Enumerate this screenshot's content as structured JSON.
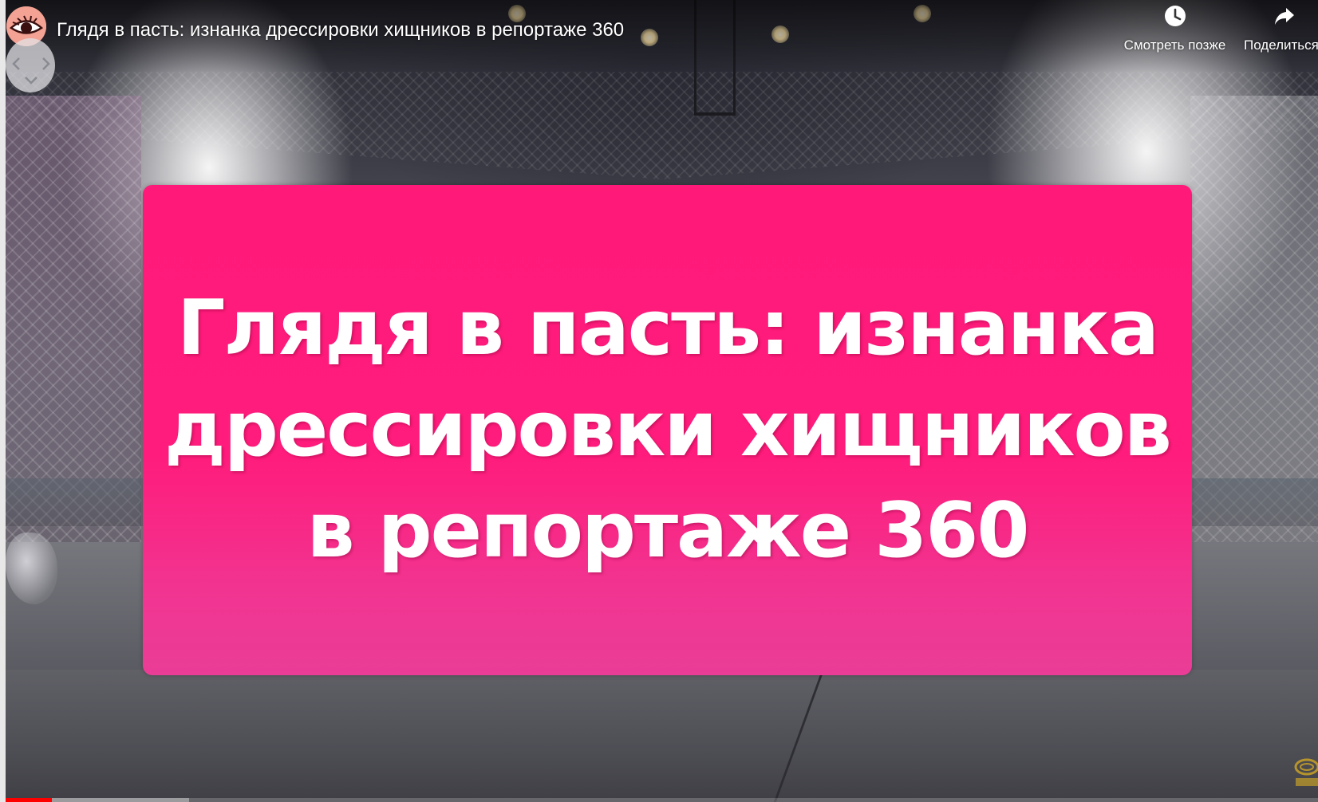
{
  "video": {
    "title": "Глядя в пасть: изнанка дрессировки хищников в репортаже 360",
    "overlay_text": "Глядя в пасть: изнанка дрессировки хищников в репортаже 360"
  },
  "actions": {
    "watch_later": {
      "label": "Смотреть позже",
      "icon": "clock-icon"
    },
    "share": {
      "label": "Поделиться",
      "icon": "share-arrow-icon"
    }
  },
  "navigation": {
    "icons": [
      "chevron-left-icon",
      "chevron-right-icon",
      "chevron-down-icon"
    ]
  },
  "channel": {
    "avatar_icon": "eye-icon"
  },
  "watermark": {
    "icon": "circus-logo-icon"
  },
  "progress": {
    "played_fraction": 0.035,
    "buffered_fraction": 0.14
  },
  "colors": {
    "card_pink": "#ff1a7a",
    "progress_red": "#ff0000",
    "avatar_bg": "#f3a293",
    "watermark_gold": "#c9a227"
  }
}
